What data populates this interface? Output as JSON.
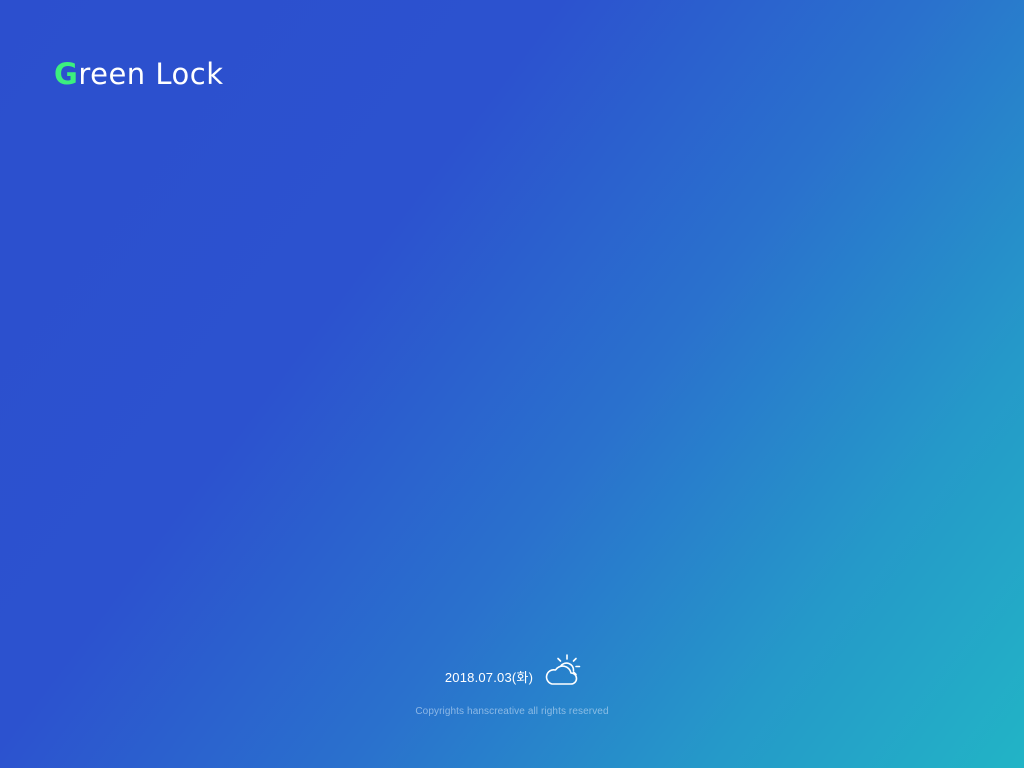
{
  "brand": {
    "logo_first_letter": "G",
    "logo_rest": "reen Lock",
    "accent_color": "#3cf07e"
  },
  "status": {
    "date": "2018.07.03(화)",
    "weather_icon": "partly-cloudy-icon"
  },
  "footer": {
    "copyright": "Copyrights hanscreative all rights reserved"
  },
  "colors": {
    "background_start": "#2c4fce",
    "background_end": "#22b4c6",
    "text": "#ffffff"
  }
}
